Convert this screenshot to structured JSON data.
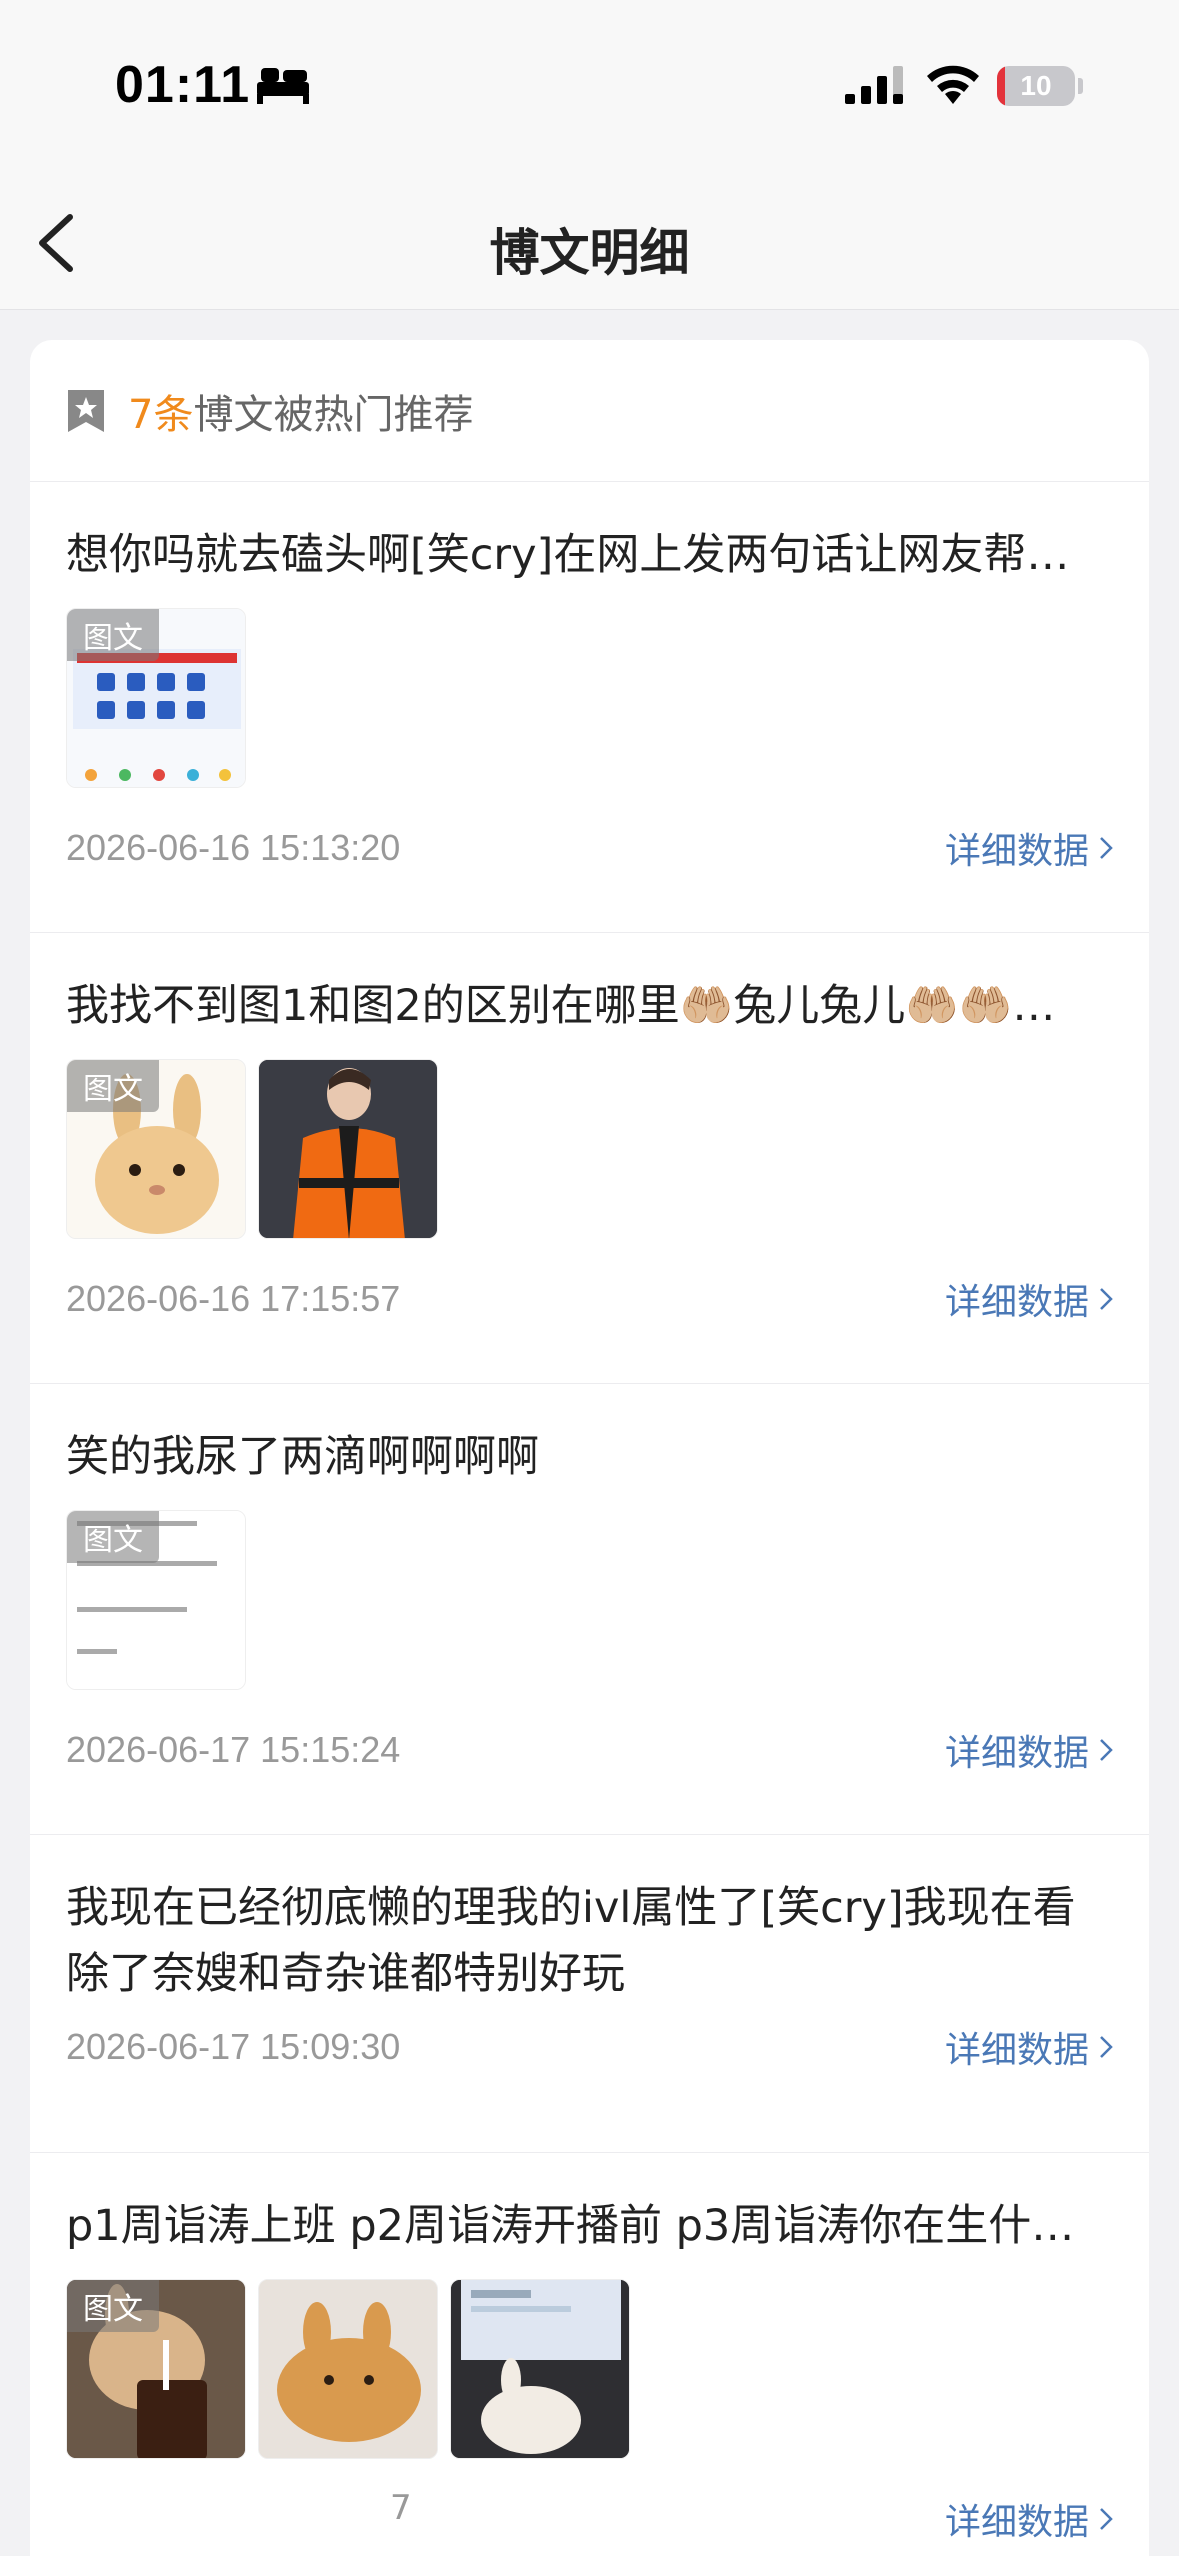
{
  "status_bar": {
    "time": "01:11",
    "battery": "10",
    "battery_level": 0.1
  },
  "nav": {
    "title": "博文明细"
  },
  "summary": {
    "count": "7条",
    "text": "博文被热门推荐"
  },
  "posts": [
    {
      "text": "想你吗就去磕头啊[笑cry]在网上发两句话让网友帮…",
      "badge": "图文",
      "time": "2026-06-16 15:13:20",
      "detail": "详细数据"
    },
    {
      "text": "我找不到图1和图2的区别在哪里🤲🏼兔儿兔儿🤲🏼🤲🏼…",
      "badge": "图文",
      "time": "2026-06-16 17:15:57",
      "detail": "详细数据"
    },
    {
      "text": "笑的我尿了两滴啊啊啊啊",
      "badge": "图文",
      "time": "2026-06-17 15:15:24",
      "detail": "详细数据"
    },
    {
      "text": "我现在已经彻底懒的理我的ivl属性了[笑cry]我现在看除了奈嫂和奇杂谁都特别好玩",
      "time": "2026-06-17 15:09:30",
      "detail": "详细数据"
    },
    {
      "text": "p1周诣涛上班 p2周诣涛开播前 p3周诣涛你在生什…",
      "badge": "图文",
      "time": "",
      "detail": "详细数据"
    }
  ],
  "page_indicator": "7",
  "colors": {
    "accent": "#f08a1c",
    "link": "#4a78b6"
  }
}
